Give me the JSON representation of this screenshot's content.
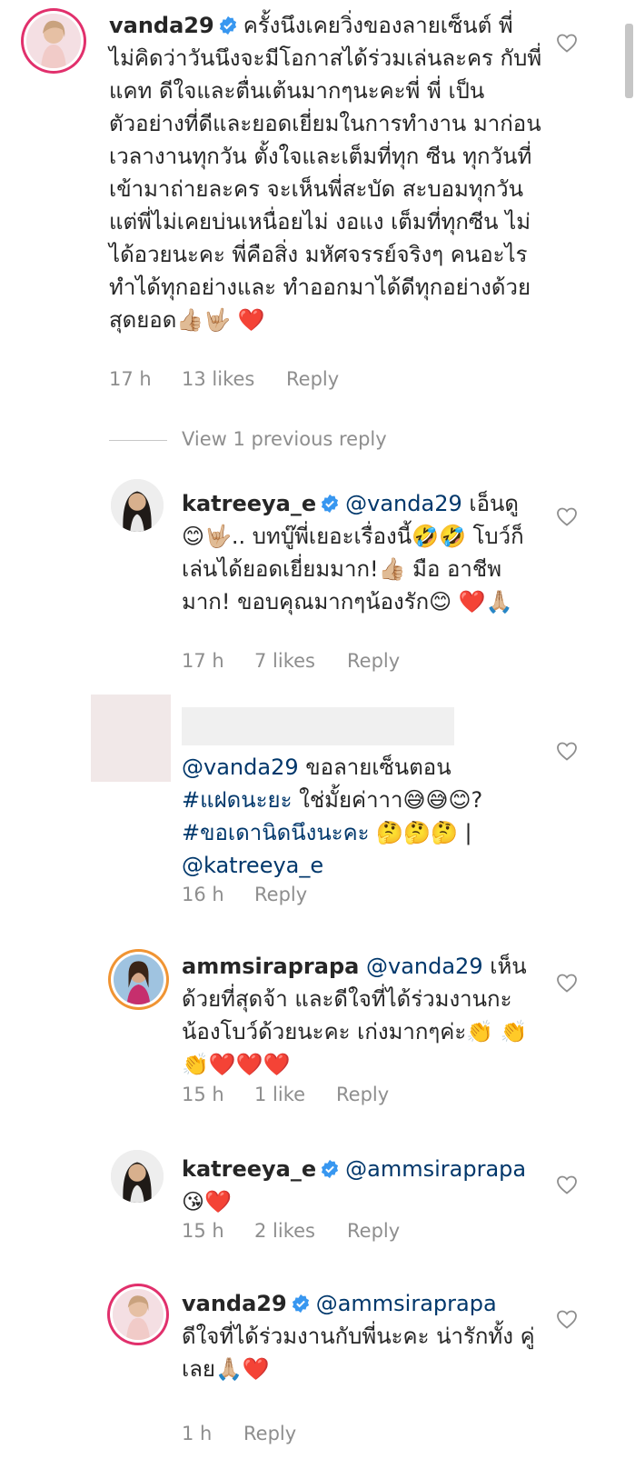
{
  "comments": [
    {
      "user": "vanda29",
      "verified": true,
      "text": "ครั้งนึงเคยวิ่งของลายเซ็นต์ พี่ ไม่คิดว่าวันนึงจะมีโอกาสได้ร่วมเล่นละคร กับพี่แคท ดีใจและตื่นเต้นมากๆนะคะพี่ พี่ เป็นตัวอย่างที่ดีและยอดเยี่ยมในการทำงาน มาก่อนเวลางานทุกวัน ตั้งใจและเต็มที่ทุก ซีน ทุกวันที่เข้ามาถ่ายละคร จะเห็นพี่สะบัด สะบอมทุกวัน แต่พี่ไม่เคยบ่นเหนื่อยไม่ งอแง เต็มที่ทุกซีน ไม่ได้อวยนะคะ พี่คือสิ่ง มหัศจรรย์จริงๆ คนอะไรทำได้ทุกอย่างและ ทำออกมาได้ดีทุกอย่างด้วย สุดยอด👍🏼🤟🏼 ❤️",
      "time": "17 h",
      "likes": "13 likes",
      "reply": "Reply"
    },
    {
      "view_previous": "View 1 previous reply"
    },
    {
      "user": "katreeya_e",
      "verified": true,
      "mention": "@vanda29",
      "text": "เอ็นดู 😊🤟🏼.. บทบู๊พี่เยอะเรื่องนี้🤣🤣 โบว์ก็เล่นได้ยอดเยี่ยมมาก!👍🏼 มือ อาชีพมาก! ขอบคุณมากๆน้องรัก😊 ❤️🙏🏼",
      "time": "17 h",
      "likes": "7 likes",
      "reply": "Reply"
    },
    {
      "user": "",
      "mention": "@vanda29",
      "text": "ขอลายเซ็นตอน",
      "hashtag1": "#แฝดนะยะ",
      "text2": "ใช่มั้ยค่าาา😅😅😊?",
      "hashtag2": "#ขอเดานิดนึงนะคะ",
      "text3": "🤔🤔🤔 |",
      "mention2": "@katreeya_e",
      "time": "16 h",
      "reply": "Reply"
    },
    {
      "user": "ammsiraprapa",
      "mention": "@vanda29",
      "text": "เห็น ด้วยที่สุดจ้า และดีใจที่ได้ร่วมงานกะ น้องโบว์ด้วยนะคะ เก่งมากๆค่ะ👏 👏👏❤️❤️❤️",
      "time": "15 h",
      "likes": "1 like",
      "reply": "Reply"
    },
    {
      "user": "katreeya_e",
      "verified": true,
      "mention": "@ammsiraprapa",
      "text": "😘❤️",
      "time": "15 h",
      "likes": "2 likes",
      "reply": "Reply"
    },
    {
      "user": "vanda29",
      "verified": true,
      "mention": "@ammsiraprapa",
      "text": "ดีใจที่ได้ร่วมงานกับพี่นะคะ น่ารักทั้ง คู่เลย🙏🏼❤️",
      "time": "1 h",
      "reply": "Reply"
    }
  ],
  "colors": {
    "username": "#262626",
    "mention": "#00376b",
    "meta": "#8e8e8e",
    "verified": "#3897f0",
    "heart": "#e3242b"
  },
  "icons": [
    "heart-outline-icon",
    "verified-badge-icon"
  ]
}
